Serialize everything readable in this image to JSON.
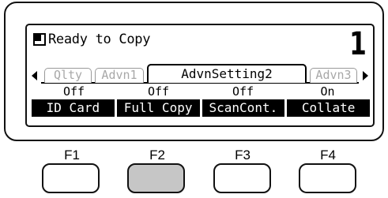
{
  "lcd": {
    "status": "Ready to Copy",
    "copies": "1",
    "tabs": [
      {
        "label": "Qlty",
        "active": false
      },
      {
        "label": "Advn1",
        "active": false
      },
      {
        "label": "AdvnSetting2",
        "active": true
      },
      {
        "label": "Advn3",
        "active": false
      }
    ],
    "values": [
      "Off",
      "Off",
      "Off",
      "On"
    ],
    "functions": [
      "ID Card",
      "Full Copy",
      "ScanCont.",
      "Collate"
    ]
  },
  "keys": [
    {
      "label": "F1",
      "pressed": false
    },
    {
      "label": "F2",
      "pressed": true
    },
    {
      "label": "F3",
      "pressed": false
    },
    {
      "label": "F4",
      "pressed": false
    }
  ],
  "colors": {
    "pressed_key": "#c6c6c6",
    "inactive_tab_text": "#a8a8a8"
  }
}
